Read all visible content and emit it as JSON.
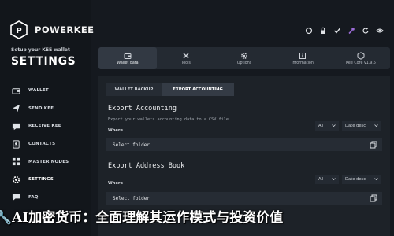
{
  "brand": {
    "name": "POWERKEE",
    "setup_subtitle": "Setup your KEE wallet",
    "section_title": "SETTINGS"
  },
  "sidebar": {
    "items": [
      {
        "label": "WALLET",
        "icon": "wallet-icon"
      },
      {
        "label": "SEND KEE",
        "icon": "send-icon"
      },
      {
        "label": "RECEIVE KEE",
        "icon": "receive-icon"
      },
      {
        "label": "CONTACTS",
        "icon": "contacts-icon"
      },
      {
        "label": "MASTER NODES",
        "icon": "master-nodes-icon"
      },
      {
        "label": "SETTINGS",
        "icon": "settings-icon",
        "active": true
      },
      {
        "label": "FAQ",
        "icon": "faq-icon"
      }
    ]
  },
  "top_icons": [
    "sync-icon",
    "lock-icon",
    "check-icon",
    "wrench-icon",
    "refresh-icon",
    "eye-icon"
  ],
  "tabs": [
    {
      "label": "Wallet data",
      "icon": "wallet-data-icon",
      "active": true
    },
    {
      "label": "Tools",
      "icon": "tools-icon"
    },
    {
      "label": "Options",
      "icon": "options-icon"
    },
    {
      "label": "Information",
      "icon": "information-icon"
    },
    {
      "label": "Kee Core v1.9.5",
      "icon": "kee-core-icon"
    }
  ],
  "subtabs": {
    "wallet_backup": "WALLET BACKUP",
    "export_accounting": "EXPORT ACCOUNTING"
  },
  "export_accounting": {
    "title": "Export Accounting",
    "description": "Export your wallets accounting data to a CSV file.",
    "where_label": "Where",
    "filter_value": "All",
    "sort_value": "Date desc",
    "field_text": "Select folder"
  },
  "export_address_book": {
    "title": "Export Address Book",
    "where_label": "Where",
    "filter_value": "All",
    "sort_value": "Date desc",
    "field_text": "Select folder"
  },
  "banner_text": "🔧AI加密货币：全面理解其运作模式与投资价值"
}
